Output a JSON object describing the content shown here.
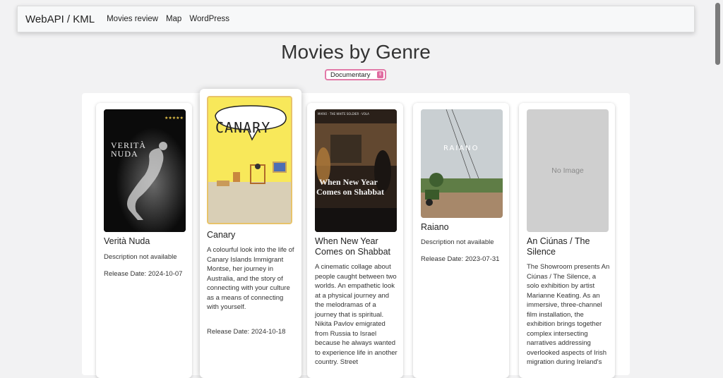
{
  "navbar": {
    "brand": "WebAPI / KML",
    "links": [
      "Movies review",
      "Map",
      "WordPress"
    ]
  },
  "page": {
    "title": "Movies by Genre"
  },
  "genre_select": {
    "selected": "Documentary"
  },
  "movies": [
    {
      "title": "Verità Nuda",
      "poster_text": [
        "VERITÀ",
        "NUDA"
      ],
      "description": "Description not available",
      "release": "Release Date: 2024-10-07"
    },
    {
      "title": "Canary",
      "poster_text": [
        "CANARY"
      ],
      "description": "A colourful look into the life of Canary Islands Immigrant Montse, her journey in Australia, and the story of connecting with your culture as a means of connecting with yourself.",
      "release": "Release Date: 2024-10-18"
    },
    {
      "title": "When New Year Comes on Shabbat",
      "poster_text": [
        "When New Year",
        "Comes on Shabbat"
      ],
      "description": "A cinematic collage about people caught between two worlds. An empathetic look at a physical journey and the melodramas of a journey that is spiritual. Nikita Pavlov emigrated from Russia to Israel because he always wanted to experience life in another country. Street",
      "release": ""
    },
    {
      "title": "Raiano",
      "poster_text": [
        "RAIANO"
      ],
      "description": "Description not available",
      "release": "Release Date: 2023-07-31"
    },
    {
      "title": "An Ciúnas / The Silence",
      "poster_text": [
        "No Image"
      ],
      "description": "The Showroom presents An Ciúnas / The Silence, a solo exhibition by artist Marianne Keating. As an immersive, three-channel film installation, the exhibition brings together complex intersecting narratives addressing overlooked aspects of Irish migration during Ireland's",
      "release": ""
    }
  ]
}
